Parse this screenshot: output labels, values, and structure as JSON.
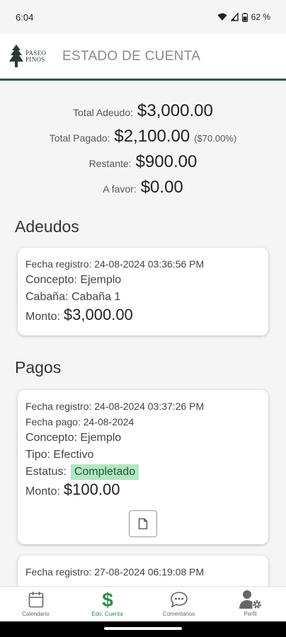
{
  "status": {
    "time": "6:04",
    "battery": "62 %"
  },
  "header": {
    "logo_line1": "PASEO",
    "logo_line2": "PINOS",
    "title": "ESTADO DE CUENTA"
  },
  "summary": {
    "total_adeudo_label": "Total Adeudo:",
    "total_adeudo_value": "$3,000.00",
    "total_pagado_label": "Total Pagado:",
    "total_pagado_value": "$2,100.00",
    "total_pagado_pct": "($70.00%)",
    "restante_label": "Restante:",
    "restante_value": "$900.00",
    "a_favor_label": "A favor:",
    "a_favor_value": "$0.00"
  },
  "adeudos": {
    "title": "Adeudos",
    "items": [
      {
        "fecha_registro": "Fecha registro: 24-08-2024 03:36:56 PM",
        "concepto": "Concepto: Ejemplo",
        "cabana": "Cabaña: Cabaña 1",
        "monto_label": "Monto:",
        "monto_value": "$3,000.00"
      }
    ]
  },
  "pagos": {
    "title": "Pagos",
    "items": [
      {
        "fecha_registro": "Fecha registro: 24-08-2024 03:37:26 PM",
        "fecha_pago": "Fecha pago: 24-08-2024",
        "concepto": "Concepto: Ejemplo",
        "tipo": "Tipo: Efectivo",
        "estatus_label": "Estatus:",
        "estatus_value": "Completado",
        "monto_label": "Monto:",
        "monto_value": "$100.00"
      },
      {
        "fecha_registro": "Fecha registro: 27-08-2024 06:19:08 PM"
      }
    ]
  },
  "nav": {
    "items": [
      {
        "label": "Calendario",
        "icon": "calendar-icon"
      },
      {
        "label": "Edo. Cuenta",
        "icon": "dollar-icon"
      },
      {
        "label": "Comentarios",
        "icon": "chat-icon"
      },
      {
        "label": "Perfil",
        "icon": "user-gear-icon"
      }
    ]
  },
  "colors": {
    "accent": "#2f8f47",
    "header_border": "#2d5a3d",
    "badge_bg": "#b2e6c4"
  }
}
